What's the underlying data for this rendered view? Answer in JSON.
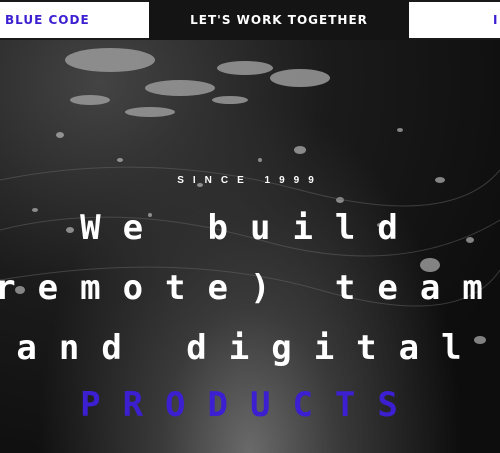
{
  "nav": {
    "left_label": "BLUE CODE",
    "center_label": "LET'S WORK TOGETHER",
    "right_label": "I"
  },
  "hero": {
    "since": "SINCE 1999",
    "line1": "We build",
    "line2": "remote) team",
    "line3": "and digital",
    "line4": "PRODUCTS",
    "accent_color": "#3b1fd1"
  }
}
